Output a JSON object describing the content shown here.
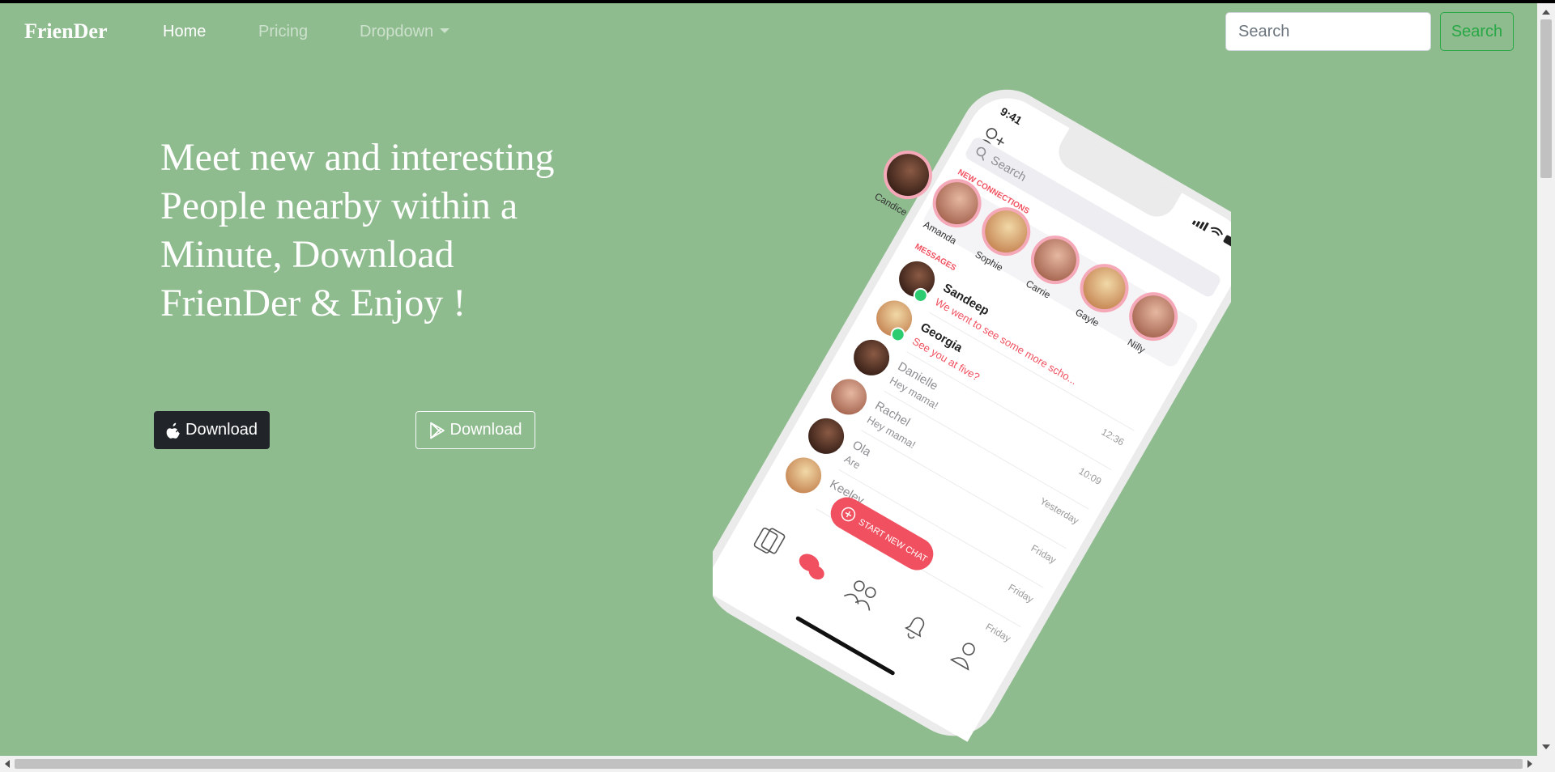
{
  "navbar": {
    "brand": "FrienDer",
    "links": [
      {
        "label": "Home",
        "active": true
      },
      {
        "label": "Pricing",
        "active": false
      },
      {
        "label": "Dropdown",
        "active": false
      }
    ],
    "search": {
      "placeholder": "Search",
      "button_label": "Search"
    }
  },
  "hero": {
    "heading_lines": [
      "Meet new and interesting",
      "People nearby within a",
      "Minute, Download",
      "FrienDer & Enjoy !"
    ],
    "buttons": [
      {
        "label": "Download",
        "icon": "apple-icon"
      },
      {
        "label": "Download",
        "icon": "google-play-icon"
      }
    ]
  },
  "phone": {
    "time": "9:41",
    "search_placeholder": "Search",
    "new_connections_label": "NEW CONNECTIONS",
    "connections": [
      "Candice",
      "Amanda",
      "Sophie",
      "Carrie",
      "Gayle",
      "Nilly"
    ],
    "messages_label": "MESSAGES",
    "messages": [
      {
        "name": "Sandeep",
        "text": "We went to see some more scho...",
        "time": "",
        "unread": true
      },
      {
        "name": "Georgia",
        "text": "See you at five?",
        "time": "12:36",
        "unread": true
      },
      {
        "name": "Danielle",
        "text": "Hey mama!",
        "time": "10:09",
        "unread": false
      },
      {
        "name": "Rachel",
        "text": "Hey mama!",
        "time": "Yesterday",
        "unread": false
      },
      {
        "name": "Ola",
        "text": "Are",
        "time": "Friday",
        "unread": false
      },
      {
        "name": "Keeley",
        "text": "",
        "time": "Friday",
        "unread": false
      },
      {
        "name": "",
        "text": "",
        "time": "Friday",
        "unread": false
      }
    ],
    "start_chat_label": "START NEW CHAT"
  },
  "colors": {
    "background": "#8fbc8f",
    "accent_red": "#f0505f",
    "success_green": "#28a745",
    "dark": "#212529"
  }
}
